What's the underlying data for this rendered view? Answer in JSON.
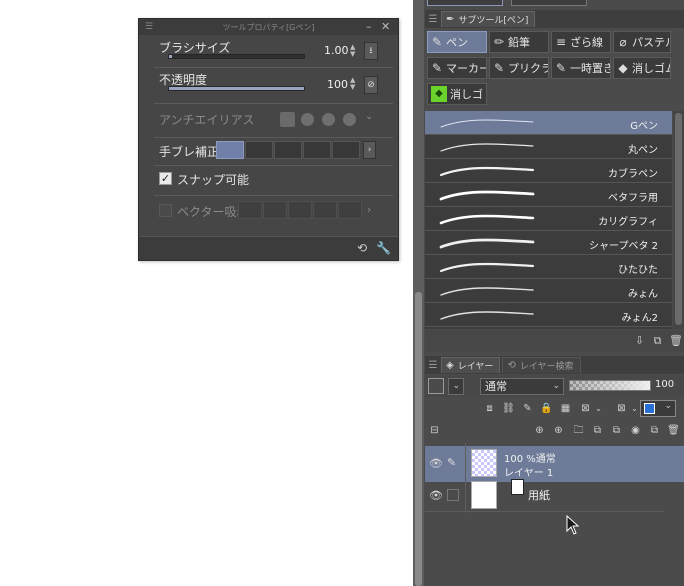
{
  "tool_property": {
    "title": "ツールプロパティ[Gペン]",
    "brush_size_label": "ブラシサイズ",
    "brush_size_value": "1.00",
    "brush_size_fill": 0.02,
    "opacity_label": "不透明度",
    "opacity_value": "100",
    "opacity_fill": 1.0,
    "antialias_label": "アンチエイリアス",
    "stabilization_label": "手ブレ補正",
    "snap_label": "スナップ可能",
    "snap_checked": true,
    "vector_snap_label": "ベクター吸着",
    "vector_snap_checked": false
  },
  "subtool": {
    "tab_label": "サブツール[ペン]",
    "tabs": [
      {
        "label": "ペン",
        "icon": "pen-icon",
        "selected": true
      },
      {
        "label": "鉛筆",
        "icon": "pencil-icon",
        "selected": false
      },
      {
        "label": "ざら線",
        "icon": "rough-line-icon",
        "selected": false
      },
      {
        "label": "パステル",
        "icon": "pastel-icon",
        "selected": false
      },
      {
        "label": "マーカー",
        "icon": "marker-icon",
        "selected": false
      },
      {
        "label": "プリクラ",
        "icon": "purikura-icon",
        "selected": false
      },
      {
        "label": "一時置き",
        "icon": "temp-icon",
        "selected": false
      },
      {
        "label": "消しゴム",
        "icon": "eraser-icon",
        "selected": false
      },
      {
        "label": "消しゴ",
        "icon": "eraser-green-icon",
        "selected": false
      }
    ],
    "brushes": [
      {
        "name": "Gペン",
        "selected": true
      },
      {
        "name": "丸ペン",
        "selected": false
      },
      {
        "name": "カブラペン",
        "selected": false
      },
      {
        "name": "ベタフラ用",
        "selected": false
      },
      {
        "name": "カリグラフィ",
        "selected": false
      },
      {
        "name": "シャープベタ 2",
        "selected": false
      },
      {
        "name": "ひたひた",
        "selected": false
      },
      {
        "name": "みょん",
        "selected": false
      },
      {
        "name": "みょん2",
        "selected": false
      }
    ]
  },
  "layer": {
    "tab_label": "レイヤー",
    "tab2_label": "レイヤー検索",
    "blend_mode": "通常",
    "opacity_value": "100",
    "layers": [
      {
        "line1": "100 %通常",
        "line2": "レイヤー 1",
        "selected": true
      },
      {
        "line1": "",
        "line2": "",
        "name": "用紙",
        "selected": false
      }
    ]
  }
}
